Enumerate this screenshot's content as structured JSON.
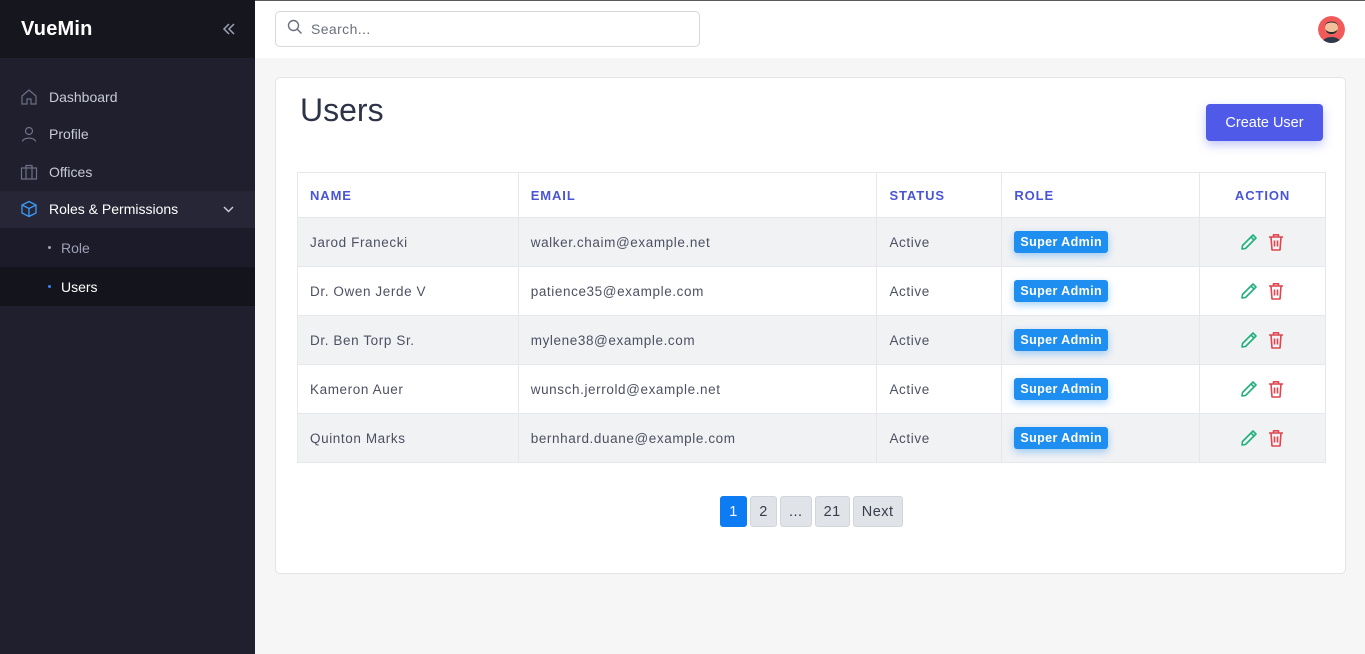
{
  "brand": "VueMin",
  "search": {
    "placeholder": "Search..."
  },
  "sidebar": {
    "items": [
      {
        "label": "Dashboard"
      },
      {
        "label": "Profile"
      },
      {
        "label": "Offices"
      },
      {
        "label": "Roles & Permissions"
      }
    ],
    "subitems": [
      {
        "label": "Role"
      },
      {
        "label": "Users"
      }
    ]
  },
  "page": {
    "title": "Users",
    "create_label": "Create User"
  },
  "table": {
    "columns": [
      "NAME",
      "EMAIL",
      "STATUS",
      "ROLE",
      "ACTION"
    ],
    "rows": [
      {
        "name": "Jarod Franecki",
        "email": "walker.chaim@example.net",
        "status": "Active",
        "role": "Super Admin"
      },
      {
        "name": "Dr. Owen Jerde V",
        "email": "patience35@example.com",
        "status": "Active",
        "role": "Super Admin"
      },
      {
        "name": "Dr. Ben Torp Sr.",
        "email": "mylene38@example.com",
        "status": "Active",
        "role": "Super Admin"
      },
      {
        "name": "Kameron Auer",
        "email": "wunsch.jerrold@example.net",
        "status": "Active",
        "role": "Super Admin"
      },
      {
        "name": "Quinton Marks",
        "email": "bernhard.duane@example.com",
        "status": "Active",
        "role": "Super Admin"
      }
    ]
  },
  "pagination": {
    "pages": [
      "1",
      "2",
      "...",
      "21"
    ],
    "current": "1",
    "next_label": "Next"
  },
  "colors": {
    "accent": "#4f5be8",
    "badge": "#1e8ef0",
    "edit": "#22b07d",
    "delete": "#e0444e",
    "sidebar": "#1f1f2e"
  },
  "icons": {
    "sidebar": [
      "home-icon",
      "user-icon",
      "building-icon",
      "cube-icon"
    ],
    "actions": [
      "pencil-icon",
      "trash-icon"
    ]
  }
}
